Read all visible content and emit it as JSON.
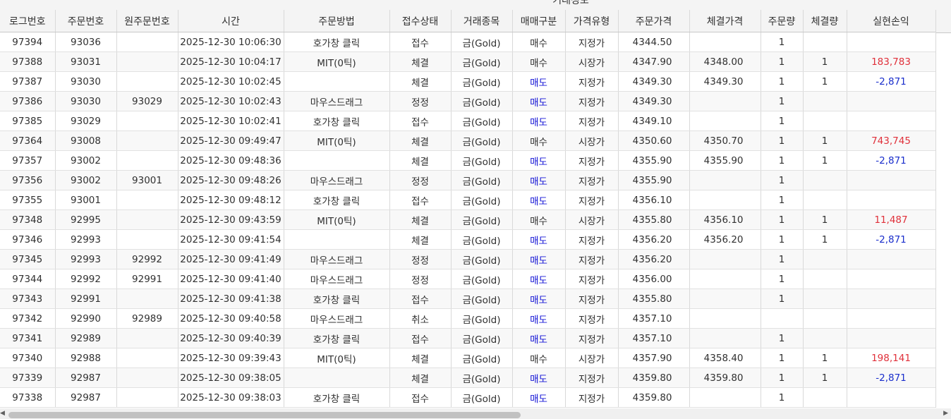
{
  "group_header": "거래정보",
  "columns": [
    "로그번호",
    "주문번호",
    "원주문번호",
    "시간",
    "주문방법",
    "접수상태",
    "거래종목",
    "매매구분",
    "가격유형",
    "주문가격",
    "체결가격",
    "주문량",
    "체결량",
    "실현손익"
  ],
  "rows": [
    [
      "97394",
      "93036",
      "",
      "2025-12-30 10:06:30",
      "호가창 클릭",
      "접수",
      "금(Gold)",
      "매수",
      "지정가",
      "4344.50",
      "",
      "1",
      "",
      ""
    ],
    [
      "97388",
      "93031",
      "",
      "2025-12-30 10:04:17",
      "MIT(0틱)",
      "체결",
      "금(Gold)",
      "매수",
      "시장가",
      "4347.90",
      "4348.00",
      "1",
      "1",
      "183,783"
    ],
    [
      "97387",
      "93030",
      "",
      "2025-12-30 10:02:45",
      "",
      "체결",
      "금(Gold)",
      "매도",
      "지정가",
      "4349.30",
      "4349.30",
      "1",
      "1",
      "-2,871"
    ],
    [
      "97386",
      "93030",
      "93029",
      "2025-12-30 10:02:43",
      "마우스드래그",
      "정정",
      "금(Gold)",
      "매도",
      "지정가",
      "4349.30",
      "",
      "1",
      "",
      ""
    ],
    [
      "97385",
      "93029",
      "",
      "2025-12-30 10:02:41",
      "호가창 클릭",
      "접수",
      "금(Gold)",
      "매도",
      "지정가",
      "4349.10",
      "",
      "1",
      "",
      ""
    ],
    [
      "97364",
      "93008",
      "",
      "2025-12-30 09:49:47",
      "MIT(0틱)",
      "체결",
      "금(Gold)",
      "매수",
      "시장가",
      "4350.60",
      "4350.70",
      "1",
      "1",
      "743,745"
    ],
    [
      "97357",
      "93002",
      "",
      "2025-12-30 09:48:36",
      "",
      "체결",
      "금(Gold)",
      "매도",
      "지정가",
      "4355.90",
      "4355.90",
      "1",
      "1",
      "-2,871"
    ],
    [
      "97356",
      "93002",
      "93001",
      "2025-12-30 09:48:26",
      "마우스드래그",
      "정정",
      "금(Gold)",
      "매도",
      "지정가",
      "4355.90",
      "",
      "1",
      "",
      ""
    ],
    [
      "97355",
      "93001",
      "",
      "2025-12-30 09:48:12",
      "호가창 클릭",
      "접수",
      "금(Gold)",
      "매도",
      "지정가",
      "4356.10",
      "",
      "1",
      "",
      ""
    ],
    [
      "97348",
      "92995",
      "",
      "2025-12-30 09:43:59",
      "MIT(0틱)",
      "체결",
      "금(Gold)",
      "매수",
      "시장가",
      "4355.80",
      "4356.10",
      "1",
      "1",
      "11,487"
    ],
    [
      "97346",
      "92993",
      "",
      "2025-12-30 09:41:54",
      "",
      "체결",
      "금(Gold)",
      "매도",
      "지정가",
      "4356.20",
      "4356.20",
      "1",
      "1",
      "-2,871"
    ],
    [
      "97345",
      "92993",
      "92992",
      "2025-12-30 09:41:49",
      "마우스드래그",
      "정정",
      "금(Gold)",
      "매도",
      "지정가",
      "4356.20",
      "",
      "1",
      "",
      ""
    ],
    [
      "97344",
      "92992",
      "92991",
      "2025-12-30 09:41:40",
      "마우스드래그",
      "정정",
      "금(Gold)",
      "매도",
      "지정가",
      "4356.00",
      "",
      "1",
      "",
      ""
    ],
    [
      "97343",
      "92991",
      "",
      "2025-12-30 09:41:38",
      "호가창 클릭",
      "접수",
      "금(Gold)",
      "매도",
      "지정가",
      "4355.80",
      "",
      "1",
      "",
      ""
    ],
    [
      "97342",
      "92990",
      "92989",
      "2025-12-30 09:40:58",
      "마우스드래그",
      "취소",
      "금(Gold)",
      "매도",
      "지정가",
      "4357.10",
      "",
      "",
      "",
      ""
    ],
    [
      "97341",
      "92989",
      "",
      "2025-12-30 09:40:39",
      "호가창 클릭",
      "접수",
      "금(Gold)",
      "매도",
      "지정가",
      "4357.10",
      "",
      "1",
      "",
      ""
    ],
    [
      "97340",
      "92988",
      "",
      "2025-12-30 09:39:43",
      "MIT(0틱)",
      "체결",
      "금(Gold)",
      "매수",
      "시장가",
      "4357.90",
      "4358.40",
      "1",
      "1",
      "198,141"
    ],
    [
      "97339",
      "92987",
      "",
      "2025-12-30 09:38:05",
      "",
      "체결",
      "금(Gold)",
      "매도",
      "지정가",
      "4359.80",
      "4359.80",
      "1",
      "1",
      "-2,871"
    ],
    [
      "97338",
      "92987",
      "",
      "2025-12-30 09:38:03",
      "호가창 클릭",
      "접수",
      "금(Gold)",
      "매도",
      "지정가",
      "4359.80",
      "",
      "1",
      "",
      ""
    ]
  ],
  "colors": {
    "sell": "#1414d6",
    "profit": "#e0303a",
    "loss": "#1a2ecc"
  },
  "scrollbar": {
    "left_icon": "arrow-left-icon",
    "right_icon": "arrow-right-icon"
  }
}
